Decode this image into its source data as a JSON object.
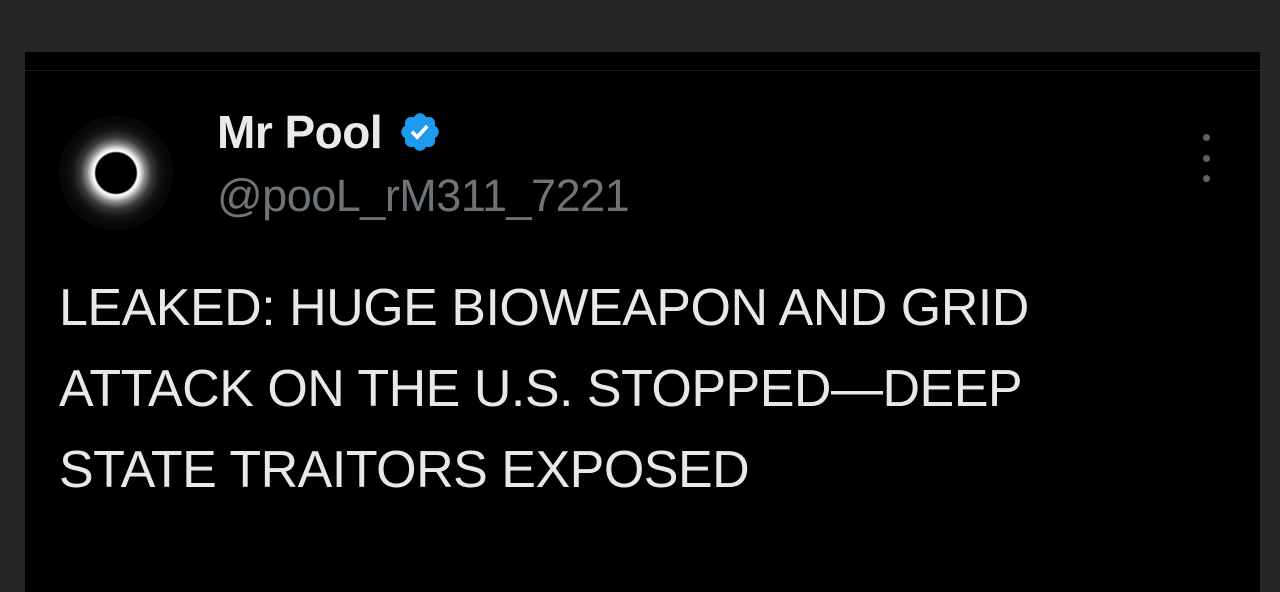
{
  "tweet": {
    "author": {
      "name": "Mr Pool",
      "handle": "@pooL_rM311_7221",
      "verified": true,
      "avatar_icon": "solar-eclipse-avatar",
      "verified_color": "#1d9bf0"
    },
    "text_lines": [
      "LEAKED: HUGE BIOWEAPON AND GRID",
      "ATTACK ON THE U.S. STOPPED—DEEP",
      "STATE TRAITORS EXPOSED"
    ],
    "more_icon": "more-vertical-icon"
  }
}
